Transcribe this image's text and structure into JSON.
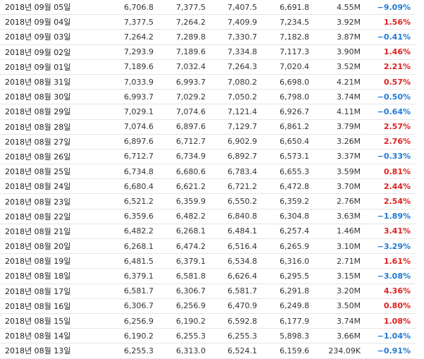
{
  "columns": [
    "date",
    "close",
    "open",
    "high",
    "low",
    "volume",
    "change"
  ],
  "colors": {
    "up": "#e0201d",
    "down": "#1e7ad6",
    "neutral": "#333333",
    "row_border": "#e6e6e6"
  },
  "rows": [
    {
      "date": "2018년 09월 05일",
      "close": "6,706.8",
      "open": "7,377.5",
      "high": "7,407.5",
      "low": "6,691.8",
      "volume": "4.55M",
      "change": "-9.09%",
      "dir": "down"
    },
    {
      "date": "2018년 09월 04일",
      "close": "7,377.5",
      "open": "7,264.2",
      "high": "7,409.9",
      "low": "7,234.5",
      "volume": "3.92M",
      "change": "1.56%",
      "dir": "up"
    },
    {
      "date": "2018년 09월 03일",
      "close": "7,264.2",
      "open": "7,289.8",
      "high": "7,330.7",
      "low": "7,182.8",
      "volume": "3.87M",
      "change": "-0.41%",
      "dir": "down"
    },
    {
      "date": "2018년 09월 02일",
      "close": "7,293.9",
      "open": "7,189.6",
      "high": "7,334.8",
      "low": "7,117.3",
      "volume": "3.90M",
      "change": "1.46%",
      "dir": "up"
    },
    {
      "date": "2018년 09월 01일",
      "close": "7,189.6",
      "open": "7,032.4",
      "high": "7,264.3",
      "low": "7,020.4",
      "volume": "3.52M",
      "change": "2.21%",
      "dir": "up"
    },
    {
      "date": "2018년 08월 31일",
      "close": "7,033.9",
      "open": "6,993.7",
      "high": "7,080.2",
      "low": "6,698.0",
      "volume": "4.21M",
      "change": "0.57%",
      "dir": "up"
    },
    {
      "date": "2018년 08월 30일",
      "close": "6,993.7",
      "open": "7,029.2",
      "high": "7,050.2",
      "low": "6,798.0",
      "volume": "3.74M",
      "change": "-0.50%",
      "dir": "down"
    },
    {
      "date": "2018년 08월 29일",
      "close": "7,029.1",
      "open": "7,074.6",
      "high": "7,121.4",
      "low": "6,926.7",
      "volume": "4.11M",
      "change": "-0.64%",
      "dir": "down"
    },
    {
      "date": "2018년 08월 28일",
      "close": "7,074.6",
      "open": "6,897.6",
      "high": "7,129.7",
      "low": "6,861.2",
      "volume": "3.79M",
      "change": "2.57%",
      "dir": "up"
    },
    {
      "date": "2018년 08월 27일",
      "close": "6,897.6",
      "open": "6,712.7",
      "high": "6,902.9",
      "low": "6,650.4",
      "volume": "3.26M",
      "change": "2.76%",
      "dir": "up"
    },
    {
      "date": "2018년 08월 26일",
      "close": "6,712.7",
      "open": "6,734.9",
      "high": "6,892.7",
      "low": "6,573.1",
      "volume": "3.37M",
      "change": "-0.33%",
      "dir": "down"
    },
    {
      "date": "2018년 08월 25일",
      "close": "6,734.8",
      "open": "6,680.6",
      "high": "6,783.4",
      "low": "6,655.3",
      "volume": "3.59M",
      "change": "0.81%",
      "dir": "up"
    },
    {
      "date": "2018년 08월 24일",
      "close": "6,680.4",
      "open": "6,621.2",
      "high": "6,721.2",
      "low": "6,472.8",
      "volume": "3.70M",
      "change": "2.44%",
      "dir": "up"
    },
    {
      "date": "2018년 08월 23일",
      "close": "6,521.2",
      "open": "6,359.9",
      "high": "6,550.2",
      "low": "6,359.2",
      "volume": "2.76M",
      "change": "2.54%",
      "dir": "up"
    },
    {
      "date": "2018년 08월 22일",
      "close": "6,359.6",
      "open": "6,482.2",
      "high": "6,840.8",
      "low": "6,304.8",
      "volume": "3.63M",
      "change": "-1.89%",
      "dir": "down"
    },
    {
      "date": "2018년 08월 21일",
      "close": "6,482.2",
      "open": "6,268.1",
      "high": "6,484.1",
      "low": "6,257.4",
      "volume": "1.46M",
      "change": "3.41%",
      "dir": "up"
    },
    {
      "date": "2018년 08월 20일",
      "close": "6,268.1",
      "open": "6,474.2",
      "high": "6,516.4",
      "low": "6,265.9",
      "volume": "3.10M",
      "change": "-3.29%",
      "dir": "down"
    },
    {
      "date": "2018년 08월 19일",
      "close": "6,481.5",
      "open": "6,379.1",
      "high": "6,534.8",
      "low": "6,316.0",
      "volume": "2.71M",
      "change": "1.61%",
      "dir": "up"
    },
    {
      "date": "2018년 08월 18일",
      "close": "6,379.1",
      "open": "6,581.8",
      "high": "6,626.4",
      "low": "6,295.5",
      "volume": "3.15M",
      "change": "-3.08%",
      "dir": "down"
    },
    {
      "date": "2018년 08월 17일",
      "close": "6,581.7",
      "open": "6,306.7",
      "high": "6,581.7",
      "low": "6,291.8",
      "volume": "3.20M",
      "change": "4.36%",
      "dir": "up"
    },
    {
      "date": "2018년 08월 16일",
      "close": "6,306.7",
      "open": "6,256.9",
      "high": "6,470.9",
      "low": "6,249.8",
      "volume": "3.50M",
      "change": "0.80%",
      "dir": "up"
    },
    {
      "date": "2018년 08월 15일",
      "close": "6,256.9",
      "open": "6,190.2",
      "high": "6,592.8",
      "low": "6,177.9",
      "volume": "3.74M",
      "change": "1.08%",
      "dir": "up"
    },
    {
      "date": "2018년 08월 14일",
      "close": "6,190.2",
      "open": "6,255.3",
      "high": "6,255.3",
      "low": "5,898.3",
      "volume": "3.66M",
      "change": "-1.04%",
      "dir": "down"
    },
    {
      "date": "2018년 08월 13일",
      "close": "6,255.3",
      "open": "6,313.0",
      "high": "6,524.1",
      "low": "6,159.6",
      "volume": "234.09K",
      "change": "-0.91%",
      "dir": "down"
    }
  ]
}
